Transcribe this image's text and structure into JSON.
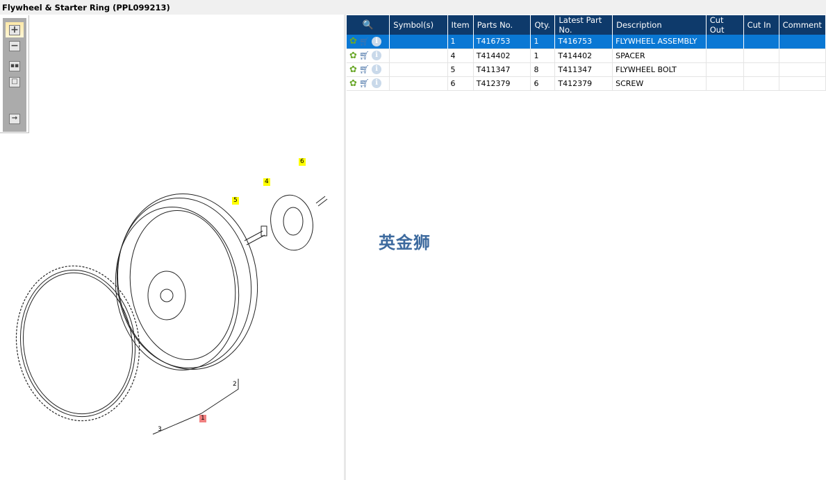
{
  "title": "Flywheel & Starter Ring (PPL099213)",
  "toolbar": {
    "items": [
      "zoom-in",
      "zoom-out",
      "fit-all",
      "actual-size",
      "toggle-list"
    ]
  },
  "table": {
    "headers": [
      "",
      "Symbol(s)",
      "Item",
      "Parts No.",
      "Qty.",
      "Latest Part No.",
      "Description",
      "Cut Out",
      "Cut In",
      "Comment"
    ],
    "rows": [
      {
        "symbols": "",
        "item": "1",
        "parts_no": "T416753",
        "qty": "1",
        "latest": "T416753",
        "description": "FLYWHEEL ASSEMBLY",
        "cut_out": "",
        "cut_in": "",
        "comment": "",
        "selected": true
      },
      {
        "symbols": "",
        "item": "4",
        "parts_no": "T414402",
        "qty": "1",
        "latest": "T414402",
        "description": "SPACER",
        "cut_out": "",
        "cut_in": "",
        "comment": ""
      },
      {
        "symbols": "",
        "item": "5",
        "parts_no": "T411347",
        "qty": "8",
        "latest": "T411347",
        "description": "FLYWHEEL BOLT",
        "cut_out": "",
        "cut_in": "",
        "comment": ""
      },
      {
        "symbols": "",
        "item": "6",
        "parts_no": "T412379",
        "qty": "6",
        "latest": "T412379",
        "description": "SCREW",
        "cut_out": "",
        "cut_in": "",
        "comment": ""
      }
    ]
  },
  "watermark": "英金狮",
  "callouts": {
    "c1": "1",
    "c2": "2",
    "c3": "3",
    "c4": "4",
    "c5": "5",
    "c6": "6"
  },
  "colors": {
    "header": "#0e3a6b",
    "selected": "#0a78d4",
    "highlight_yellow": "#ffff00",
    "highlight_red": "#f08080"
  }
}
